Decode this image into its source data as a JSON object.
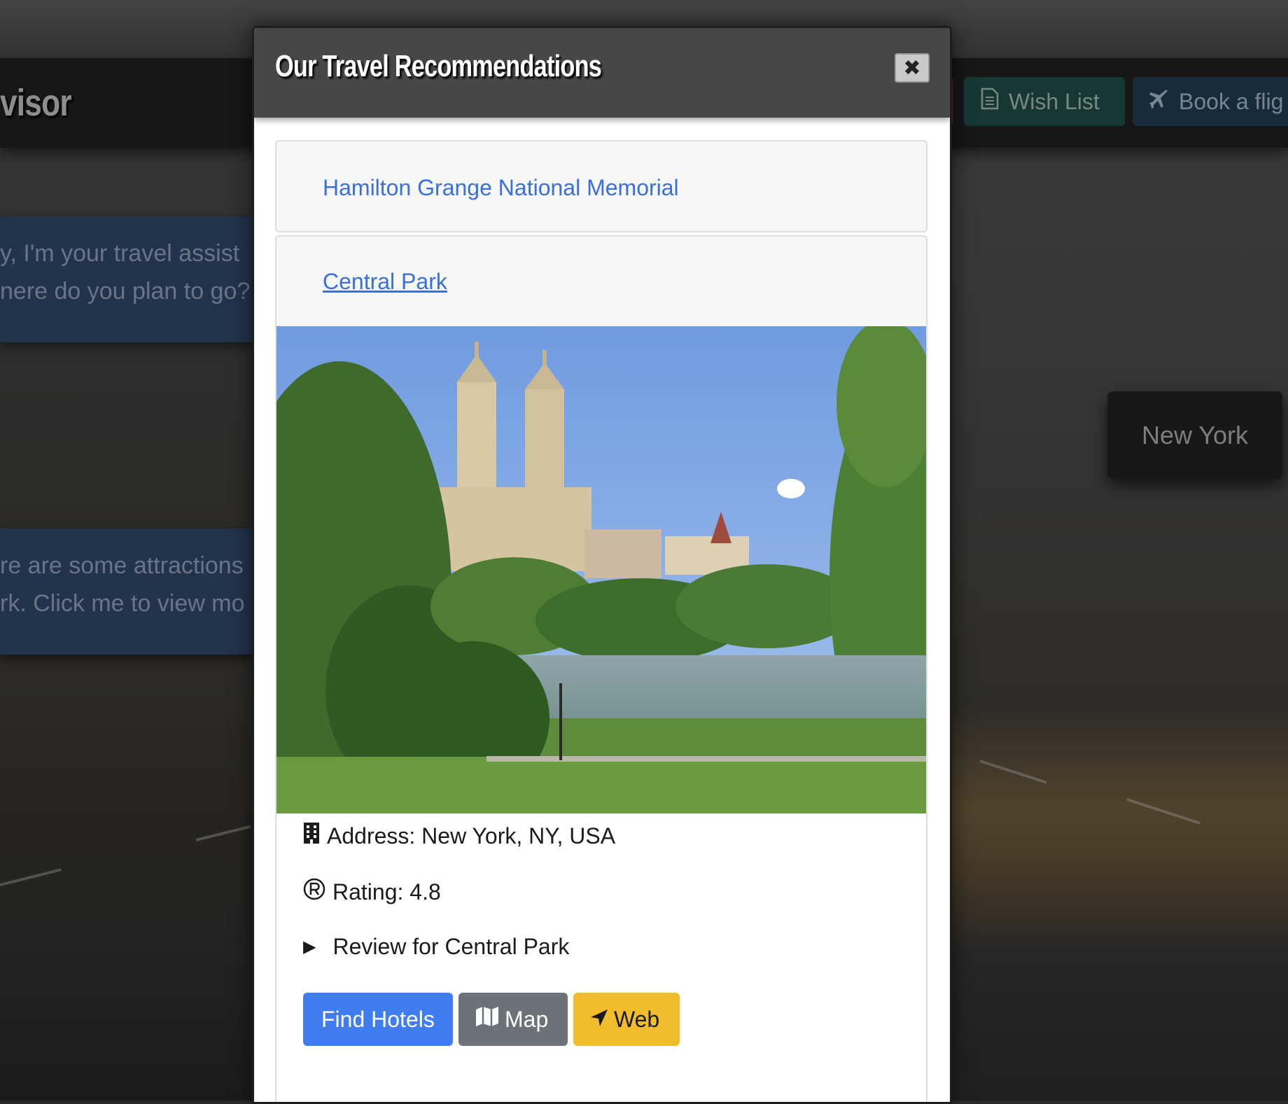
{
  "background": {
    "brand_text": "visor",
    "nav": {
      "wish_list_label": "Wish List",
      "book_label": "Book a flig"
    },
    "chat": {
      "bubble1_line1": "y, I'm your travel assist",
      "bubble1_line2": "nere do you plan to go?",
      "bubble2_line1": "re are some attractions",
      "bubble2_line2": "rk. Click me to view mo"
    },
    "chip_label": "New York"
  },
  "modal": {
    "title": "Our Travel Recommendations",
    "close_label": "✖",
    "recommendations": [
      {
        "name": "Hamilton Grange National Memorial"
      },
      {
        "name": "Central Park"
      }
    ],
    "details": {
      "address": "Address: New York, NY, USA",
      "rating": "Rating: 4.8",
      "review_summary": "Review for Central Park"
    },
    "buttons": {
      "hotels": "Find Hotels",
      "map": "Map",
      "web": "Web"
    },
    "colors": {
      "hotels": "#3f7df1",
      "map": "#6d7278",
      "web": "#f1bd2c",
      "link": "#3a6fe0"
    },
    "icons": {
      "address": "building-icon",
      "rating": "registered-icon",
      "review": "disclosure-triangle-icon",
      "map": "map-icon",
      "web": "location-arrow-icon",
      "wish": "document-icon",
      "book": "plane-icon"
    }
  }
}
